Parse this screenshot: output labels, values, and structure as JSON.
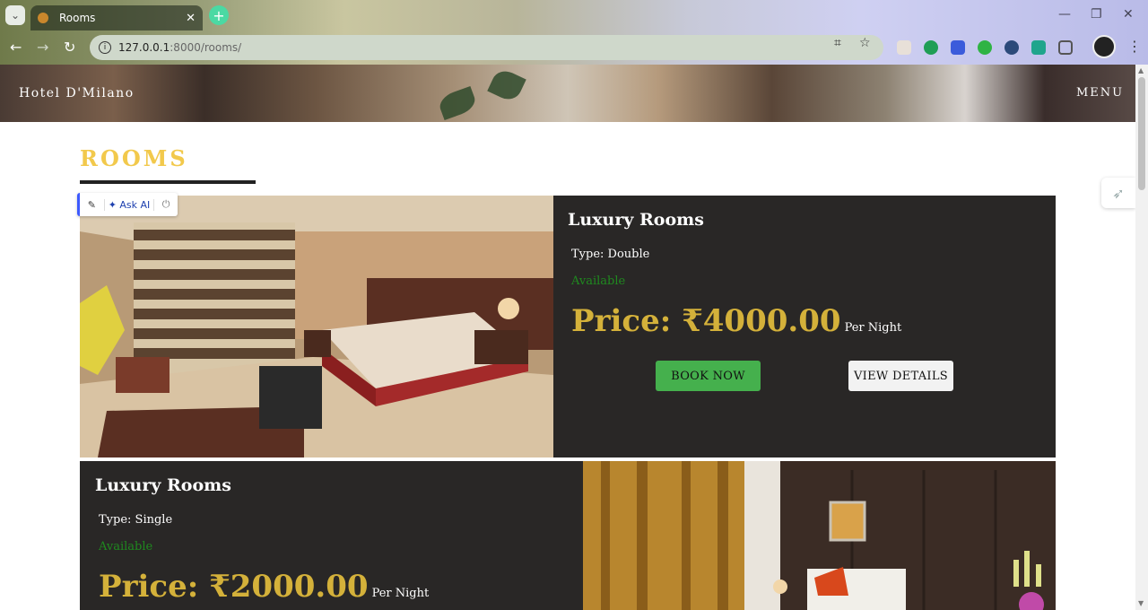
{
  "browser": {
    "tab_title": "Rooms",
    "url_host": "127.0.0.1",
    "url_rest": ":8000/rooms/",
    "new_tab": "+",
    "close": "✕",
    "back": "←",
    "forward": "→",
    "reload": "↻"
  },
  "site": {
    "brand": "Hotel D'Milano",
    "menu": "MENU",
    "heading": "ROOMS"
  },
  "rooms": [
    {
      "title": "Luxury Rooms",
      "type": "Type: Double",
      "availability": "Available",
      "price": "Price: ₹4000.00",
      "per": "Per Night",
      "book": "BOOK NOW",
      "details": "VIEW DETAILS"
    },
    {
      "title": "Luxury Rooms",
      "type": "Type: Single",
      "availability": "Available",
      "price": "Price: ₹2000.00",
      "per": "Per Night"
    }
  ],
  "ai_toolbar": {
    "ask": "✦ Ask AI"
  },
  "colors": {
    "accent_gold": "#f2c94c",
    "price_gold": "#d4b13a",
    "card_bg": "#292726",
    "book_green": "#45b04d",
    "available_green": "#1f8a1f"
  }
}
